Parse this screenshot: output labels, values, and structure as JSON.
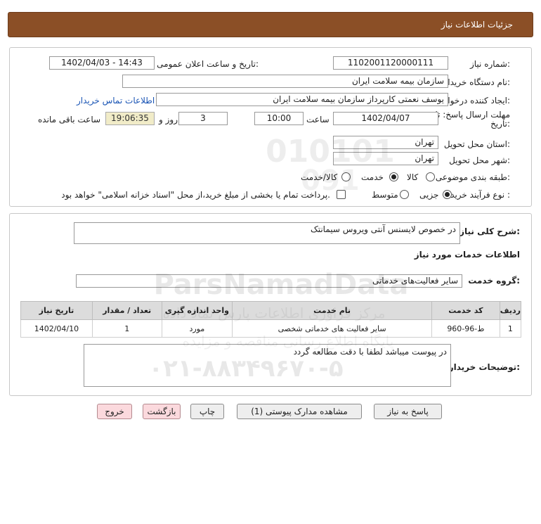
{
  "header": {
    "title": "جزئیات اطلاعات نیاز"
  },
  "fields": {
    "need_number_label": "شماره نیاز:",
    "need_number": "1102001120000111",
    "announce_label": "تاریخ و ساعت اعلان عمومی:",
    "announce_value": "1402/04/03 - 14:43",
    "buyer_org_label": "نام دستگاه خریدار:",
    "buyer_org": "سازمان بیمه سلامت ایران",
    "requester_label": "ایجاد کننده درخواست:",
    "requester": "یوسف نعمتی کارپرداز سازمان بیمه سلامت ایران",
    "contact_link": "اطلاعات تماس خریدار",
    "deadline_label": "مهلت ارسال پاسخ: تا تاریخ:",
    "deadline_date": "1402/04/07",
    "time_label": "ساعت",
    "deadline_time": "10:00",
    "days_value": "3",
    "days_label": "روز و",
    "countdown": "19:06:35",
    "remaining_label": "ساعت باقی مانده",
    "province_label": "استان محل تحویل:",
    "province": "تهران",
    "city_label": "شهر محل تحویل:",
    "city": "تهران",
    "category_label": "طبقه بندی موضوعی:",
    "category_options": [
      "کالا",
      "خدمت",
      "کالا/خدمت"
    ],
    "category_selected": "خدمت",
    "process_label": "نوع فرآیند خرید :",
    "process_options": [
      "جزیی",
      "متوسط"
    ],
    "process_selected": "جزیی",
    "treasury_note": "پرداخت تمام یا بخشی از مبلغ خرید،از محل \"اسناد خزانه اسلامی\" خواهد بود."
  },
  "description": {
    "label": "شرح کلی نیاز:",
    "value": "در خصوص لایسنس آنتی ویروس سیمانتک"
  },
  "services": {
    "section_title": "اطلاعات خدمات مورد نیاز",
    "group_label": "گروه خدمت:",
    "group_value": "سایر فعالیت‌های خدماتی",
    "columns": [
      "ردیف",
      "کد خدمت",
      "نام خدمت",
      "واحد اندازه گیری",
      "تعداد / مقدار",
      "تاریخ نیاز"
    ],
    "rows": [
      [
        "1",
        "ط-96-960",
        "سایر فعالیت های خدماتی شخصی",
        "مورد",
        "1",
        "1402/04/10"
      ]
    ]
  },
  "buyer_notes": {
    "label": "توضیحات خریدار:",
    "value": "در پیوست میباشد لطفا با دقت مطالعه گردد"
  },
  "buttons": {
    "reply": "پاسخ به نیاز",
    "attachments": "مشاهده مدارک پیوستی (1)",
    "print": "چاپ",
    "back": "بازگشت",
    "exit": "خروج"
  },
  "watermark": {
    "brand": "ParsNamadData",
    "line1": "مرکز فراوری اطلاعات پارس نماد داده",
    "line2": "پایگاه اطلاع رسانی مناقصه و مزایده",
    "phone": "۰۲۱-۸۸۳۴۹۶۷۰-۵"
  }
}
